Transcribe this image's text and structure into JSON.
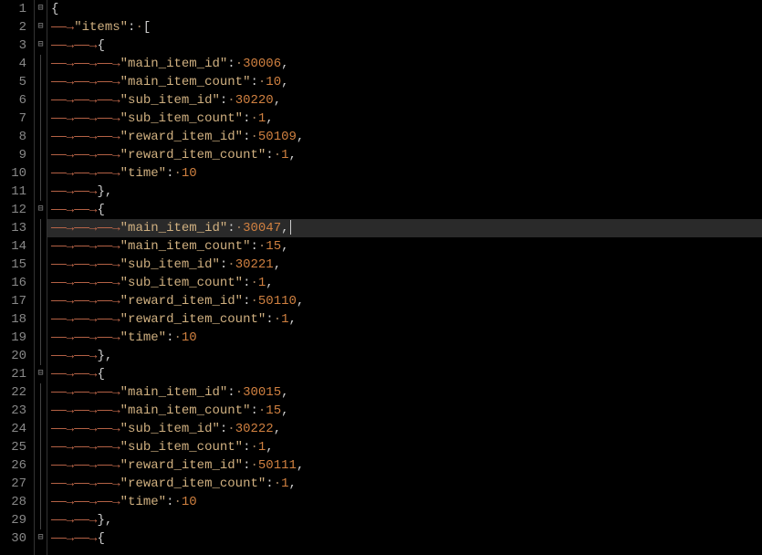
{
  "editor": {
    "current_line": 13,
    "lines": [
      {
        "n": 1,
        "fold": "open",
        "indent": 0,
        "tokens": [
          {
            "t": "punct",
            "v": "{"
          }
        ]
      },
      {
        "n": 2,
        "fold": "open",
        "indent": 1,
        "tokens": [
          {
            "t": "key",
            "v": "\"items\""
          },
          {
            "t": "colon",
            "v": ":"
          },
          {
            "t": "dot",
            "v": "·"
          },
          {
            "t": "punct",
            "v": "["
          }
        ]
      },
      {
        "n": 3,
        "fold": "open",
        "indent": 2,
        "tokens": [
          {
            "t": "punct",
            "v": "{"
          }
        ]
      },
      {
        "n": 4,
        "fold": "line",
        "indent": 3,
        "tokens": [
          {
            "t": "key",
            "v": "\"main_item_id\""
          },
          {
            "t": "colon",
            "v": ":"
          },
          {
            "t": "dot",
            "v": "·"
          },
          {
            "t": "num",
            "v": "30006"
          },
          {
            "t": "punct",
            "v": ","
          }
        ]
      },
      {
        "n": 5,
        "fold": "line",
        "indent": 3,
        "tokens": [
          {
            "t": "key",
            "v": "\"main_item_count\""
          },
          {
            "t": "colon",
            "v": ":"
          },
          {
            "t": "dot",
            "v": "·"
          },
          {
            "t": "num",
            "v": "10"
          },
          {
            "t": "punct",
            "v": ","
          }
        ]
      },
      {
        "n": 6,
        "fold": "line",
        "indent": 3,
        "tokens": [
          {
            "t": "key",
            "v": "\"sub_item_id\""
          },
          {
            "t": "colon",
            "v": ":"
          },
          {
            "t": "dot",
            "v": "·"
          },
          {
            "t": "num",
            "v": "30220"
          },
          {
            "t": "punct",
            "v": ","
          }
        ]
      },
      {
        "n": 7,
        "fold": "line",
        "indent": 3,
        "tokens": [
          {
            "t": "key",
            "v": "\"sub_item_count\""
          },
          {
            "t": "colon",
            "v": ":"
          },
          {
            "t": "dot",
            "v": "·"
          },
          {
            "t": "num",
            "v": "1"
          },
          {
            "t": "punct",
            "v": ","
          }
        ]
      },
      {
        "n": 8,
        "fold": "line",
        "indent": 3,
        "tokens": [
          {
            "t": "key",
            "v": "\"reward_item_id\""
          },
          {
            "t": "colon",
            "v": ":"
          },
          {
            "t": "dot",
            "v": "·"
          },
          {
            "t": "num",
            "v": "50109"
          },
          {
            "t": "punct",
            "v": ","
          }
        ]
      },
      {
        "n": 9,
        "fold": "line",
        "indent": 3,
        "tokens": [
          {
            "t": "key",
            "v": "\"reward_item_count\""
          },
          {
            "t": "colon",
            "v": ":"
          },
          {
            "t": "dot",
            "v": "·"
          },
          {
            "t": "num",
            "v": "1"
          },
          {
            "t": "punct",
            "v": ","
          }
        ]
      },
      {
        "n": 10,
        "fold": "line",
        "indent": 3,
        "tokens": [
          {
            "t": "key",
            "v": "\"time\""
          },
          {
            "t": "colon",
            "v": ":"
          },
          {
            "t": "dot",
            "v": "·"
          },
          {
            "t": "num",
            "v": "10"
          }
        ]
      },
      {
        "n": 11,
        "fold": "line",
        "indent": 2,
        "tokens": [
          {
            "t": "punct",
            "v": "},"
          }
        ]
      },
      {
        "n": 12,
        "fold": "open",
        "indent": 2,
        "tokens": [
          {
            "t": "punct",
            "v": "{"
          }
        ]
      },
      {
        "n": 13,
        "fold": "line",
        "indent": 3,
        "tokens": [
          {
            "t": "key",
            "v": "\"main_item_id\""
          },
          {
            "t": "colon",
            "v": ":"
          },
          {
            "t": "dot",
            "v": "·"
          },
          {
            "t": "num",
            "v": "30047"
          },
          {
            "t": "punct",
            "v": ","
          }
        ],
        "cursor": true
      },
      {
        "n": 14,
        "fold": "line",
        "indent": 3,
        "tokens": [
          {
            "t": "key",
            "v": "\"main_item_count\""
          },
          {
            "t": "colon",
            "v": ":"
          },
          {
            "t": "dot",
            "v": "·"
          },
          {
            "t": "num",
            "v": "15"
          },
          {
            "t": "punct",
            "v": ","
          }
        ]
      },
      {
        "n": 15,
        "fold": "line",
        "indent": 3,
        "tokens": [
          {
            "t": "key",
            "v": "\"sub_item_id\""
          },
          {
            "t": "colon",
            "v": ":"
          },
          {
            "t": "dot",
            "v": "·"
          },
          {
            "t": "num",
            "v": "30221"
          },
          {
            "t": "punct",
            "v": ","
          }
        ]
      },
      {
        "n": 16,
        "fold": "line",
        "indent": 3,
        "tokens": [
          {
            "t": "key",
            "v": "\"sub_item_count\""
          },
          {
            "t": "colon",
            "v": ":"
          },
          {
            "t": "dot",
            "v": "·"
          },
          {
            "t": "num",
            "v": "1"
          },
          {
            "t": "punct",
            "v": ","
          }
        ]
      },
      {
        "n": 17,
        "fold": "line",
        "indent": 3,
        "tokens": [
          {
            "t": "key",
            "v": "\"reward_item_id\""
          },
          {
            "t": "colon",
            "v": ":"
          },
          {
            "t": "dot",
            "v": "·"
          },
          {
            "t": "num",
            "v": "50110"
          },
          {
            "t": "punct",
            "v": ","
          }
        ]
      },
      {
        "n": 18,
        "fold": "line",
        "indent": 3,
        "tokens": [
          {
            "t": "key",
            "v": "\"reward_item_count\""
          },
          {
            "t": "colon",
            "v": ":"
          },
          {
            "t": "dot",
            "v": "·"
          },
          {
            "t": "num",
            "v": "1"
          },
          {
            "t": "punct",
            "v": ","
          }
        ]
      },
      {
        "n": 19,
        "fold": "line",
        "indent": 3,
        "tokens": [
          {
            "t": "key",
            "v": "\"time\""
          },
          {
            "t": "colon",
            "v": ":"
          },
          {
            "t": "dot",
            "v": "·"
          },
          {
            "t": "num",
            "v": "10"
          }
        ]
      },
      {
        "n": 20,
        "fold": "line",
        "indent": 2,
        "tokens": [
          {
            "t": "punct",
            "v": "},"
          }
        ]
      },
      {
        "n": 21,
        "fold": "open",
        "indent": 2,
        "tokens": [
          {
            "t": "punct",
            "v": "{"
          }
        ]
      },
      {
        "n": 22,
        "fold": "line",
        "indent": 3,
        "tokens": [
          {
            "t": "key",
            "v": "\"main_item_id\""
          },
          {
            "t": "colon",
            "v": ":"
          },
          {
            "t": "dot",
            "v": "·"
          },
          {
            "t": "num",
            "v": "30015"
          },
          {
            "t": "punct",
            "v": ","
          }
        ]
      },
      {
        "n": 23,
        "fold": "line",
        "indent": 3,
        "tokens": [
          {
            "t": "key",
            "v": "\"main_item_count\""
          },
          {
            "t": "colon",
            "v": ":"
          },
          {
            "t": "dot",
            "v": "·"
          },
          {
            "t": "num",
            "v": "15"
          },
          {
            "t": "punct",
            "v": ","
          }
        ]
      },
      {
        "n": 24,
        "fold": "line",
        "indent": 3,
        "tokens": [
          {
            "t": "key",
            "v": "\"sub_item_id\""
          },
          {
            "t": "colon",
            "v": ":"
          },
          {
            "t": "dot",
            "v": "·"
          },
          {
            "t": "num",
            "v": "30222"
          },
          {
            "t": "punct",
            "v": ","
          }
        ]
      },
      {
        "n": 25,
        "fold": "line",
        "indent": 3,
        "tokens": [
          {
            "t": "key",
            "v": "\"sub_item_count\""
          },
          {
            "t": "colon",
            "v": ":"
          },
          {
            "t": "dot",
            "v": "·"
          },
          {
            "t": "num",
            "v": "1"
          },
          {
            "t": "punct",
            "v": ","
          }
        ]
      },
      {
        "n": 26,
        "fold": "line",
        "indent": 3,
        "tokens": [
          {
            "t": "key",
            "v": "\"reward_item_id\""
          },
          {
            "t": "colon",
            "v": ":"
          },
          {
            "t": "dot",
            "v": "·"
          },
          {
            "t": "num",
            "v": "50111"
          },
          {
            "t": "punct",
            "v": ","
          }
        ]
      },
      {
        "n": 27,
        "fold": "line",
        "indent": 3,
        "tokens": [
          {
            "t": "key",
            "v": "\"reward_item_count\""
          },
          {
            "t": "colon",
            "v": ":"
          },
          {
            "t": "dot",
            "v": "·"
          },
          {
            "t": "num",
            "v": "1"
          },
          {
            "t": "punct",
            "v": ","
          }
        ]
      },
      {
        "n": 28,
        "fold": "line",
        "indent": 3,
        "tokens": [
          {
            "t": "key",
            "v": "\"time\""
          },
          {
            "t": "colon",
            "v": ":"
          },
          {
            "t": "dot",
            "v": "·"
          },
          {
            "t": "num",
            "v": "10"
          }
        ]
      },
      {
        "n": 29,
        "fold": "line",
        "indent": 2,
        "tokens": [
          {
            "t": "punct",
            "v": "},"
          }
        ]
      },
      {
        "n": 30,
        "fold": "open",
        "indent": 2,
        "tokens": [
          {
            "t": "punct",
            "v": "{"
          }
        ]
      }
    ],
    "arrow_glyph": "——→",
    "fold_open_glyph": "⊟"
  },
  "content_data": {
    "items": [
      {
        "main_item_id": 30006,
        "main_item_count": 10,
        "sub_item_id": 30220,
        "sub_item_count": 1,
        "reward_item_id": 50109,
        "reward_item_count": 1,
        "time": 10
      },
      {
        "main_item_id": 30047,
        "main_item_count": 15,
        "sub_item_id": 30221,
        "sub_item_count": 1,
        "reward_item_id": 50110,
        "reward_item_count": 1,
        "time": 10
      },
      {
        "main_item_id": 30015,
        "main_item_count": 15,
        "sub_item_id": 30222,
        "sub_item_count": 1,
        "reward_item_id": 50111,
        "reward_item_count": 1,
        "time": 10
      }
    ]
  }
}
